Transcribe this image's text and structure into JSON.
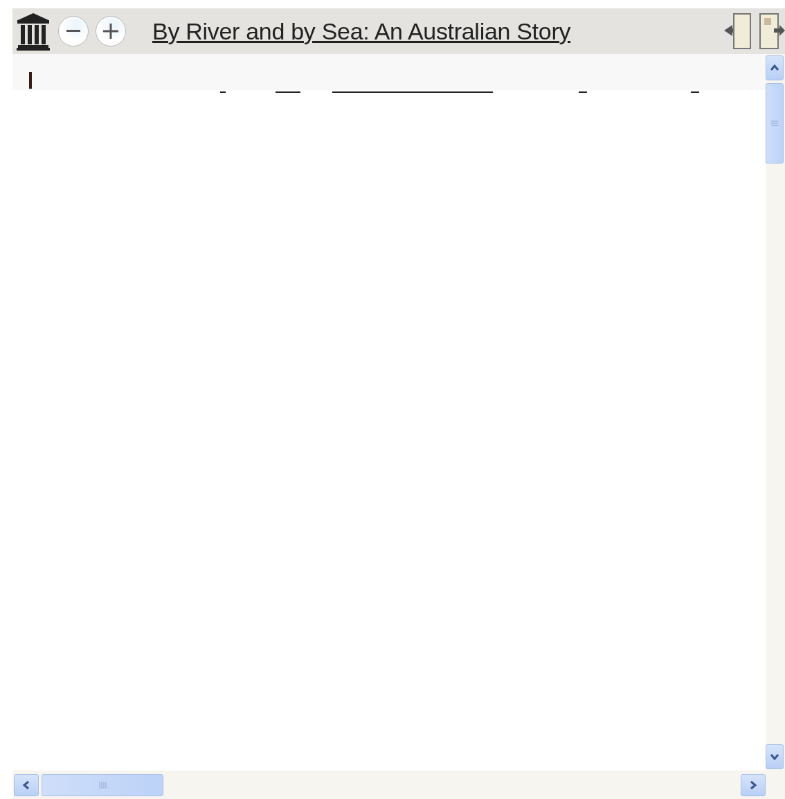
{
  "toolbar": {
    "title": "By River and by Sea: An Australian Story"
  }
}
